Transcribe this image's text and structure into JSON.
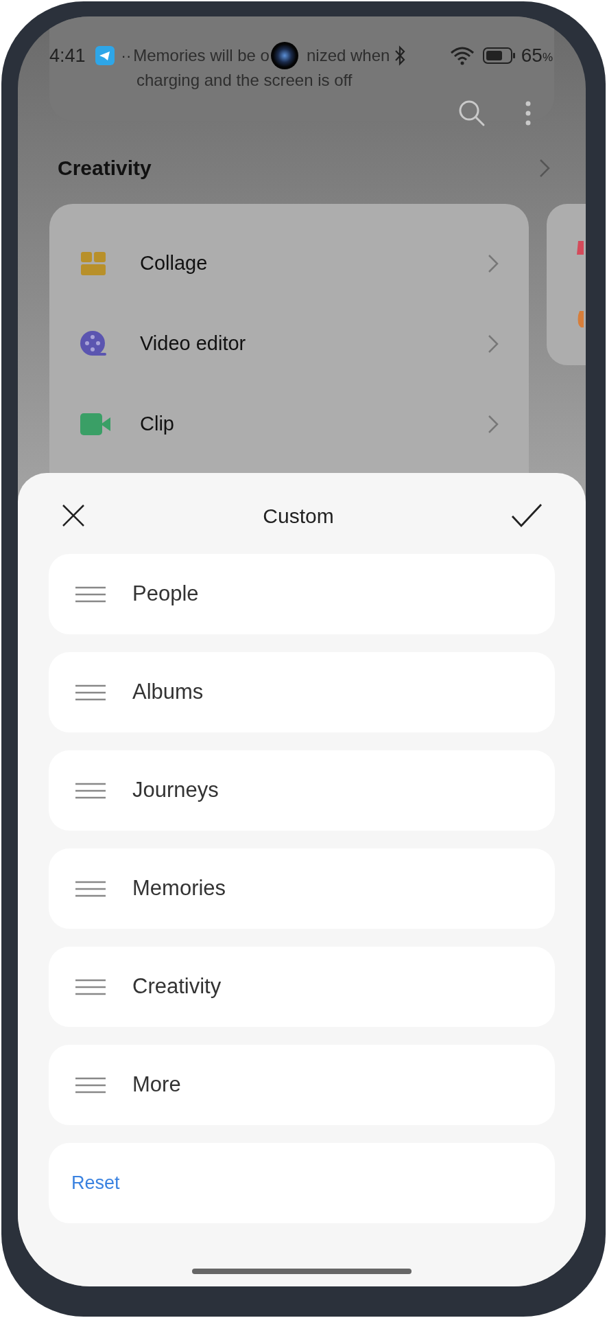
{
  "status_bar": {
    "time": "4:41",
    "dots": "··",
    "battery": "65",
    "battery_unit": "%"
  },
  "memories_card": {
    "message_fragments": [
      "Memories will be o",
      "nized when"
    ],
    "message_line_2": "charging and the screen is off"
  },
  "section": {
    "title": "Creativity"
  },
  "creativity_items": [
    {
      "label": "Collage",
      "kind": "collage"
    },
    {
      "label": "Video editor",
      "kind": "video"
    },
    {
      "label": "Clip",
      "kind": "clip"
    }
  ],
  "sheet": {
    "title": "Custom",
    "items": [
      "People",
      "Albums",
      "Journeys",
      "Memories",
      "Creativity",
      "More"
    ],
    "reset": "Reset"
  }
}
